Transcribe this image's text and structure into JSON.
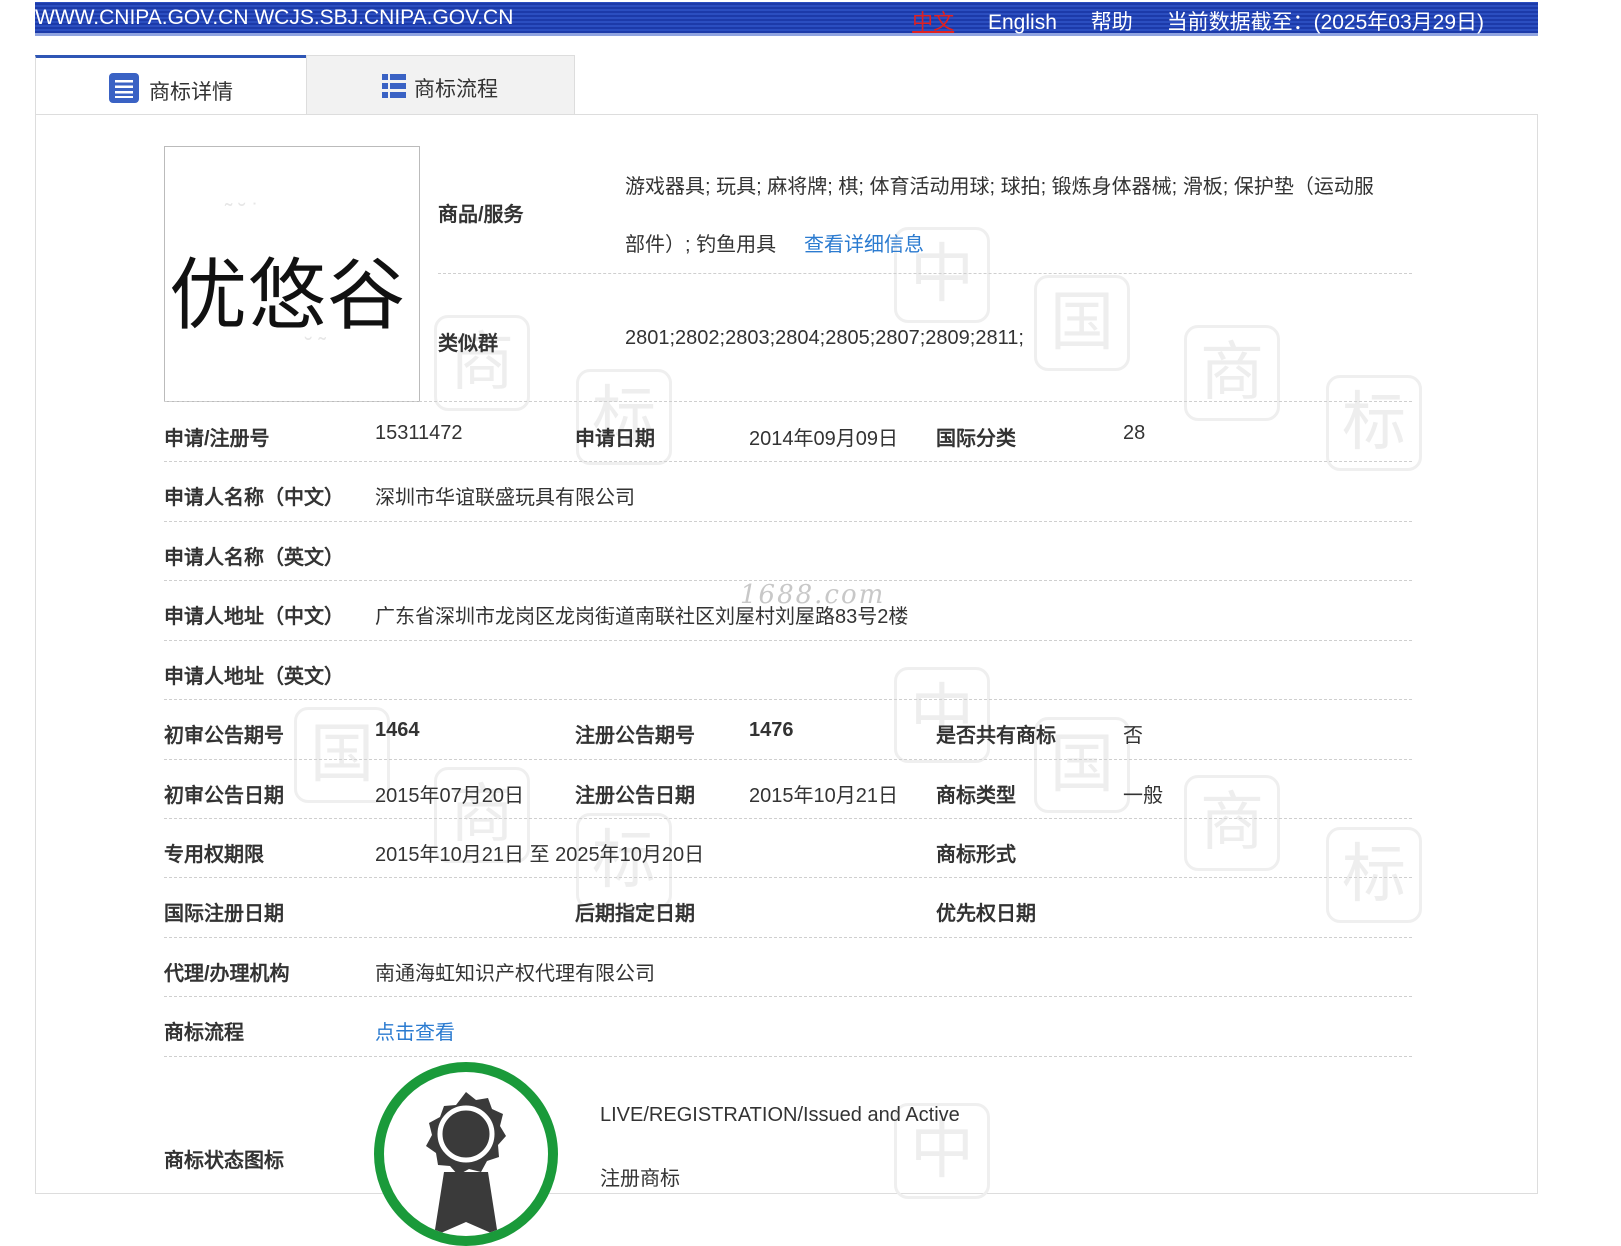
{
  "topbar": {
    "domains": "WWW.CNIPA.GOV.CN WCJS.SBJ.CNIPA.GOV.CN",
    "lang_zh": "中文",
    "lang_en": "English",
    "help": "帮助",
    "data_as_of": "当前数据截至：(2025年03月29日)"
  },
  "tabs": [
    {
      "label": "商标详情",
      "active": true,
      "icon": "list-icon"
    },
    {
      "label": "商标流程",
      "active": false,
      "icon": "grid-list-icon"
    }
  ],
  "trademark": {
    "image_text": "优悠谷",
    "goods_label": "商品/服务",
    "goods_line1": "游戏器具; 玩具; 麻将牌; 棋; 体育活动用球; 球拍; 锻炼身体器械; 滑板; 保护垫（运动服",
    "goods_line2": "部件）; 钓鱼用具",
    "goods_more": "查看详细信息",
    "similar_label": "类似群",
    "similar_value": "2801;2802;2803;2804;2805;2807;2809;2811;"
  },
  "rows": {
    "reg_no_label": "申请/注册号",
    "reg_no": "15311472",
    "apply_date_label": "申请日期",
    "apply_date": "2014年09月09日",
    "intl_class_label": "国际分类",
    "intl_class": "28",
    "applicant_cn_label": "申请人名称（中文）",
    "applicant_cn": "深圳市华谊联盛玩具有限公司",
    "applicant_en_label": "申请人名称（英文）",
    "address_cn_label": "申请人地址（中文）",
    "address_cn": "广东省深圳市龙岗区龙岗街道南联社区刘屋村刘屋路83号2楼",
    "address_en_label": "申请人地址（英文）",
    "prelim_no_label": "初审公告期号",
    "prelim_no": "1464",
    "reg_notice_no_label": "注册公告期号",
    "reg_notice_no": "1476",
    "shared_label": "是否共有商标",
    "shared": "否",
    "prelim_date_label": "初审公告日期",
    "prelim_date": "2015年07月20日",
    "reg_notice_date_label": "注册公告日期",
    "reg_notice_date": "2015年10月21日",
    "tm_type_label": "商标类型",
    "tm_type": "一般",
    "term_label": "专用权期限",
    "term": "2015年10月21日 至 2025年10月20日",
    "tm_form_label": "商标形式",
    "intl_reg_date_label": "国际注册日期",
    "later_date_label": "后期指定日期",
    "priority_date_label": "优先权日期",
    "agent_label": "代理/办理机构",
    "agent": "南通海虹知识产权代理有限公司",
    "process_label": "商标流程",
    "process_link": "点击查看",
    "status_icon_label": "商标状态图标",
    "status_en": "LIVE/REGISTRATION/Issued and Active",
    "status_cn": "注册商标"
  },
  "watermark_text": "1688.com",
  "colors": {
    "topbar": "#1c3aa9",
    "link": "#2b7bd0",
    "tab_active_border": "#2f56b5",
    "seal_ring": "#1a9a3a",
    "lang_zh": "#e02020"
  }
}
